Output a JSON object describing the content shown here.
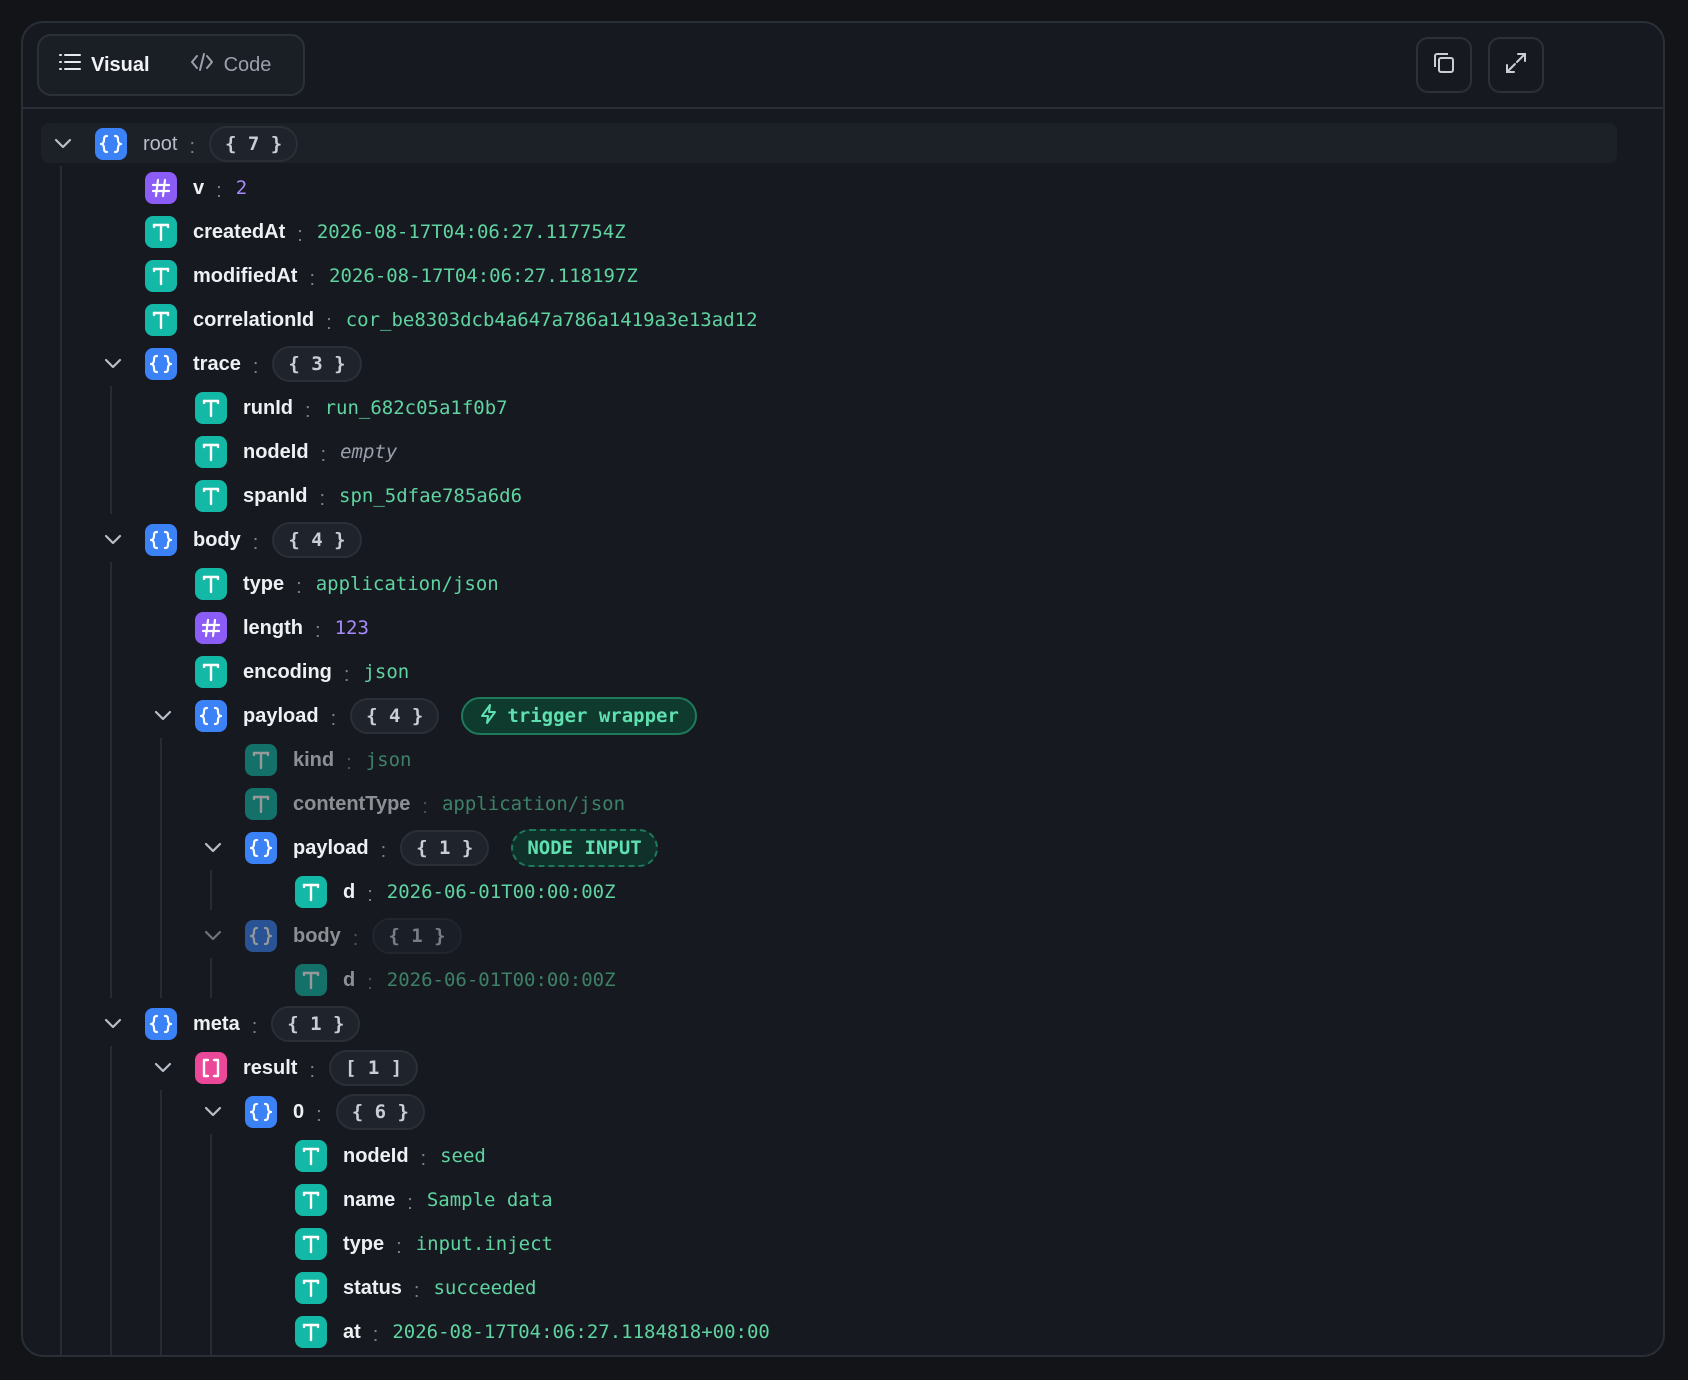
{
  "toolbar": {
    "tab_visual": "Visual",
    "tab_code": "Code",
    "copy_icon": "copy-icon",
    "expand_icon": "expand-icon"
  },
  "colors": {
    "object": "#3b82f6",
    "number": "#8b5cf6",
    "string": "#14b8a6",
    "array": "#ec4899",
    "string_value": "#5fd4a0",
    "number_value": "#a78bfa"
  },
  "rows": [
    {
      "key": "root",
      "type": "obj",
      "count": "{ 7 }",
      "depth": 0
    },
    {
      "key": "v",
      "type": "num",
      "value": "2",
      "depth": 1
    },
    {
      "key": "createdAt",
      "type": "str",
      "value": "2026-08-17T04:06:27.117754Z",
      "depth": 1
    },
    {
      "key": "modifiedAt",
      "type": "str",
      "value": "2026-08-17T04:06:27.118197Z",
      "depth": 1
    },
    {
      "key": "correlationId",
      "type": "str",
      "value": "cor_be8303dcb4a647a786a1419a3e13ad12",
      "depth": 1
    },
    {
      "key": "trace",
      "type": "obj",
      "count": "{ 3 }",
      "depth": 1
    },
    {
      "key": "runId",
      "type": "str",
      "value": "run_682c05a1f0b7",
      "depth": 2
    },
    {
      "key": "nodeId",
      "type": "str",
      "value": "empty",
      "empty": true,
      "depth": 2
    },
    {
      "key": "spanId",
      "type": "str",
      "value": "spn_5dfae785a6d6",
      "depth": 2
    },
    {
      "key": "body",
      "type": "obj",
      "count": "{ 4 }",
      "depth": 1
    },
    {
      "key": "type",
      "type": "str",
      "value": "application/json",
      "depth": 2
    },
    {
      "key": "length",
      "type": "num",
      "value": "123",
      "depth": 2
    },
    {
      "key": "encoding",
      "type": "str",
      "value": "json",
      "depth": 2
    },
    {
      "key": "payload",
      "type": "obj",
      "count": "{ 4 }",
      "tag": "trigger wrapper",
      "tag_style": "trigger",
      "depth": 2
    },
    {
      "key": "kind",
      "type": "str",
      "value": "json",
      "dim": true,
      "depth": 3
    },
    {
      "key": "contentType",
      "type": "str",
      "value": "application/json",
      "dim": true,
      "depth": 3
    },
    {
      "key": "payload",
      "type": "obj",
      "count": "{ 1 }",
      "tag": "NODE INPUT",
      "tag_style": "node",
      "depth": 3
    },
    {
      "key": "d",
      "type": "str",
      "value": "2026-06-01T00:00:00Z",
      "depth": 4
    },
    {
      "key": "body",
      "type": "obj",
      "count": "{ 1 }",
      "dim": true,
      "depth": 3
    },
    {
      "key": "d",
      "type": "str",
      "value": "2026-06-01T00:00:00Z",
      "dim": true,
      "depth": 4
    },
    {
      "key": "meta",
      "type": "obj",
      "count": "{ 1 }",
      "depth": 1
    },
    {
      "key": "result",
      "type": "arr",
      "count": "[ 1 ]",
      "depth": 2
    },
    {
      "key": "0",
      "type": "obj",
      "count": "{ 6 }",
      "depth": 3
    },
    {
      "key": "nodeId",
      "type": "str",
      "value": "seed",
      "depth": 4
    },
    {
      "key": "name",
      "type": "str",
      "value": "Sample data",
      "depth": 4
    },
    {
      "key": "type",
      "type": "str",
      "value": "input.inject",
      "depth": 4
    },
    {
      "key": "status",
      "type": "str",
      "value": "succeeded",
      "depth": 4
    },
    {
      "key": "at",
      "type": "str",
      "value": "2026-08-17T04:06:27.1184818+00:00",
      "depth": 4
    }
  ]
}
